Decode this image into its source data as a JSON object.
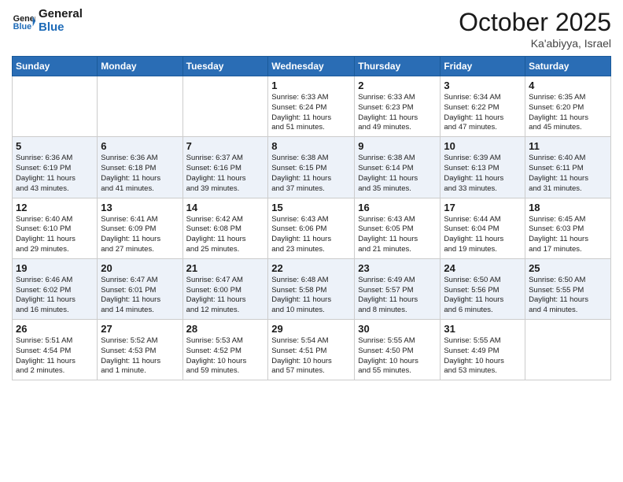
{
  "header": {
    "logo_general": "General",
    "logo_blue": "Blue",
    "month": "October 2025",
    "location": "Ka'abiyya, Israel"
  },
  "days_of_week": [
    "Sunday",
    "Monday",
    "Tuesday",
    "Wednesday",
    "Thursday",
    "Friday",
    "Saturday"
  ],
  "weeks": [
    [
      {
        "day": "",
        "info": ""
      },
      {
        "day": "",
        "info": ""
      },
      {
        "day": "",
        "info": ""
      },
      {
        "day": "1",
        "info": "Sunrise: 6:33 AM\nSunset: 6:24 PM\nDaylight: 11 hours\nand 51 minutes."
      },
      {
        "day": "2",
        "info": "Sunrise: 6:33 AM\nSunset: 6:23 PM\nDaylight: 11 hours\nand 49 minutes."
      },
      {
        "day": "3",
        "info": "Sunrise: 6:34 AM\nSunset: 6:22 PM\nDaylight: 11 hours\nand 47 minutes."
      },
      {
        "day": "4",
        "info": "Sunrise: 6:35 AM\nSunset: 6:20 PM\nDaylight: 11 hours\nand 45 minutes."
      }
    ],
    [
      {
        "day": "5",
        "info": "Sunrise: 6:36 AM\nSunset: 6:19 PM\nDaylight: 11 hours\nand 43 minutes."
      },
      {
        "day": "6",
        "info": "Sunrise: 6:36 AM\nSunset: 6:18 PM\nDaylight: 11 hours\nand 41 minutes."
      },
      {
        "day": "7",
        "info": "Sunrise: 6:37 AM\nSunset: 6:16 PM\nDaylight: 11 hours\nand 39 minutes."
      },
      {
        "day": "8",
        "info": "Sunrise: 6:38 AM\nSunset: 6:15 PM\nDaylight: 11 hours\nand 37 minutes."
      },
      {
        "day": "9",
        "info": "Sunrise: 6:38 AM\nSunset: 6:14 PM\nDaylight: 11 hours\nand 35 minutes."
      },
      {
        "day": "10",
        "info": "Sunrise: 6:39 AM\nSunset: 6:13 PM\nDaylight: 11 hours\nand 33 minutes."
      },
      {
        "day": "11",
        "info": "Sunrise: 6:40 AM\nSunset: 6:11 PM\nDaylight: 11 hours\nand 31 minutes."
      }
    ],
    [
      {
        "day": "12",
        "info": "Sunrise: 6:40 AM\nSunset: 6:10 PM\nDaylight: 11 hours\nand 29 minutes."
      },
      {
        "day": "13",
        "info": "Sunrise: 6:41 AM\nSunset: 6:09 PM\nDaylight: 11 hours\nand 27 minutes."
      },
      {
        "day": "14",
        "info": "Sunrise: 6:42 AM\nSunset: 6:08 PM\nDaylight: 11 hours\nand 25 minutes."
      },
      {
        "day": "15",
        "info": "Sunrise: 6:43 AM\nSunset: 6:06 PM\nDaylight: 11 hours\nand 23 minutes."
      },
      {
        "day": "16",
        "info": "Sunrise: 6:43 AM\nSunset: 6:05 PM\nDaylight: 11 hours\nand 21 minutes."
      },
      {
        "day": "17",
        "info": "Sunrise: 6:44 AM\nSunset: 6:04 PM\nDaylight: 11 hours\nand 19 minutes."
      },
      {
        "day": "18",
        "info": "Sunrise: 6:45 AM\nSunset: 6:03 PM\nDaylight: 11 hours\nand 17 minutes."
      }
    ],
    [
      {
        "day": "19",
        "info": "Sunrise: 6:46 AM\nSunset: 6:02 PM\nDaylight: 11 hours\nand 16 minutes."
      },
      {
        "day": "20",
        "info": "Sunrise: 6:47 AM\nSunset: 6:01 PM\nDaylight: 11 hours\nand 14 minutes."
      },
      {
        "day": "21",
        "info": "Sunrise: 6:47 AM\nSunset: 6:00 PM\nDaylight: 11 hours\nand 12 minutes."
      },
      {
        "day": "22",
        "info": "Sunrise: 6:48 AM\nSunset: 5:58 PM\nDaylight: 11 hours\nand 10 minutes."
      },
      {
        "day": "23",
        "info": "Sunrise: 6:49 AM\nSunset: 5:57 PM\nDaylight: 11 hours\nand 8 minutes."
      },
      {
        "day": "24",
        "info": "Sunrise: 6:50 AM\nSunset: 5:56 PM\nDaylight: 11 hours\nand 6 minutes."
      },
      {
        "day": "25",
        "info": "Sunrise: 6:50 AM\nSunset: 5:55 PM\nDaylight: 11 hours\nand 4 minutes."
      }
    ],
    [
      {
        "day": "26",
        "info": "Sunrise: 5:51 AM\nSunset: 4:54 PM\nDaylight: 11 hours\nand 2 minutes."
      },
      {
        "day": "27",
        "info": "Sunrise: 5:52 AM\nSunset: 4:53 PM\nDaylight: 11 hours\nand 1 minute."
      },
      {
        "day": "28",
        "info": "Sunrise: 5:53 AM\nSunset: 4:52 PM\nDaylight: 10 hours\nand 59 minutes."
      },
      {
        "day": "29",
        "info": "Sunrise: 5:54 AM\nSunset: 4:51 PM\nDaylight: 10 hours\nand 57 minutes."
      },
      {
        "day": "30",
        "info": "Sunrise: 5:55 AM\nSunset: 4:50 PM\nDaylight: 10 hours\nand 55 minutes."
      },
      {
        "day": "31",
        "info": "Sunrise: 5:55 AM\nSunset: 4:49 PM\nDaylight: 10 hours\nand 53 minutes."
      },
      {
        "day": "",
        "info": ""
      }
    ]
  ]
}
